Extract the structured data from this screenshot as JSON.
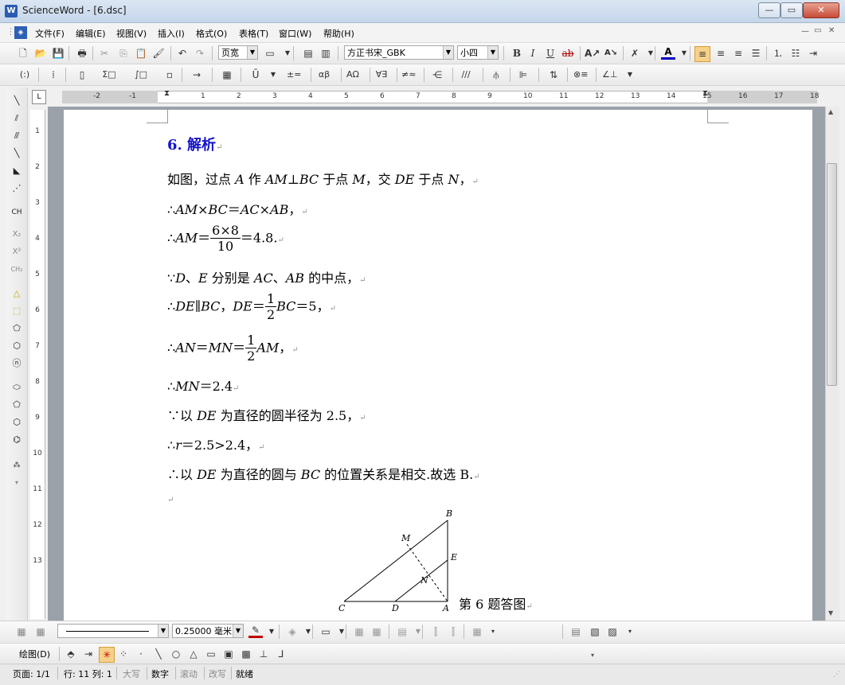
{
  "window": {
    "title": "ScienceWord - [6.dsc]",
    "app_icon": "W"
  },
  "menu": [
    "文件(F)",
    "编辑(E)",
    "视图(V)",
    "插入(I)",
    "格式(O)",
    "表格(T)",
    "窗口(W)",
    "帮助(H)"
  ],
  "toolbar1": {
    "view_mode": "页宽",
    "font_name": "方正书宋_GBK",
    "font_size": "小四",
    "bold": "B",
    "italic": "I",
    "underline": "U",
    "strike": "ab"
  },
  "toolbar2": [
    "(:)",
    "Σ□",
    "∫□",
    "±=",
    "αβ",
    "ΑΩ",
    "∀∃",
    "≠≈",
    "∕∕∕",
    "⊗≡",
    "∠⊥"
  ],
  "left_tools": [
    "CH",
    "X₂",
    "X²",
    "CH₂"
  ],
  "ruler": {
    "h_ticks": [
      "-2",
      "-1",
      "1",
      "2",
      "3",
      "4",
      "5",
      "6",
      "7",
      "8",
      "9",
      "10",
      "11",
      "12",
      "13",
      "14",
      "15",
      "16",
      "17",
      "18"
    ],
    "v_ticks": [
      "1",
      "2",
      "3",
      "4",
      "5",
      "6",
      "7",
      "8",
      "9",
      "10",
      "11",
      "12",
      "13"
    ],
    "corner": "L"
  },
  "doc": {
    "heading": "6. 解析",
    "line1": {
      "a": "如图，过点 ",
      "b": "A",
      "c": " 作 ",
      "d": "AM",
      "e": "⊥",
      "f": "BC",
      "g": " 于点 ",
      "h": "M",
      "i": "，交 ",
      "j": "DE",
      "k": " 于点 ",
      "l": "N",
      "m": "，"
    },
    "line2": {
      "a": "∴",
      "b": "AM",
      "c": "×",
      "d": "BC",
      "e": "＝",
      "f": "AC",
      "g": "×",
      "h": "AB",
      "i": "，"
    },
    "line3": {
      "a": "∴",
      "b": "AM",
      "c": "＝",
      "num": "6×8",
      "den": "10",
      "d": "＝4.8."
    },
    "line4": {
      "a": "∵",
      "b": "D",
      "c": "、",
      "d": "E",
      "e": " 分别是 ",
      "f": "AC",
      "g": "、",
      "h": "AB",
      "i": " 的中点，"
    },
    "line5": {
      "a": "∴",
      "b": "DE",
      "c": "∥",
      "d": "BC",
      "e": "，",
      "f": "DE",
      "g": "＝",
      "num": "1",
      "den": "2",
      "h": "BC",
      "i": "＝5，"
    },
    "line6": {
      "a": "∴",
      "b": "AN",
      "c": "＝",
      "d": "MN",
      "e": "＝",
      "num": "1",
      "den": "2",
      "f": "AM",
      "g": "，"
    },
    "line7": {
      "a": "∴",
      "b": "MN",
      "c": "＝2.4"
    },
    "line8": {
      "a": "∵以 ",
      "b": "DE",
      "c": " 为直径的圆半径为 2.5，"
    },
    "line9": {
      "a": "∴",
      "b": "r",
      "c": "＝2.5>2.4，"
    },
    "line10": {
      "a": "∴以 ",
      "b": "DE",
      "c": " 为直径的圆与 ",
      "d": "BC",
      "e": " 的位置关系是相交.故选 B."
    },
    "para_mark": "↵",
    "figure": {
      "labels": {
        "B": "B",
        "M": "M",
        "E": "E",
        "N": "N",
        "C": "C",
        "D": "D",
        "A": "A"
      },
      "caption": "第 6 题答图"
    }
  },
  "bottom_toolbar": {
    "line_width": "0.25000 毫米",
    "draw_label": "绘图(D)"
  },
  "status": {
    "page": "页面: 1/1",
    "position": "行: 11 列: 1",
    "caps": "大写",
    "num": "数字",
    "scroll": "滚动",
    "overwrite": "改写",
    "ready": "就绪"
  }
}
